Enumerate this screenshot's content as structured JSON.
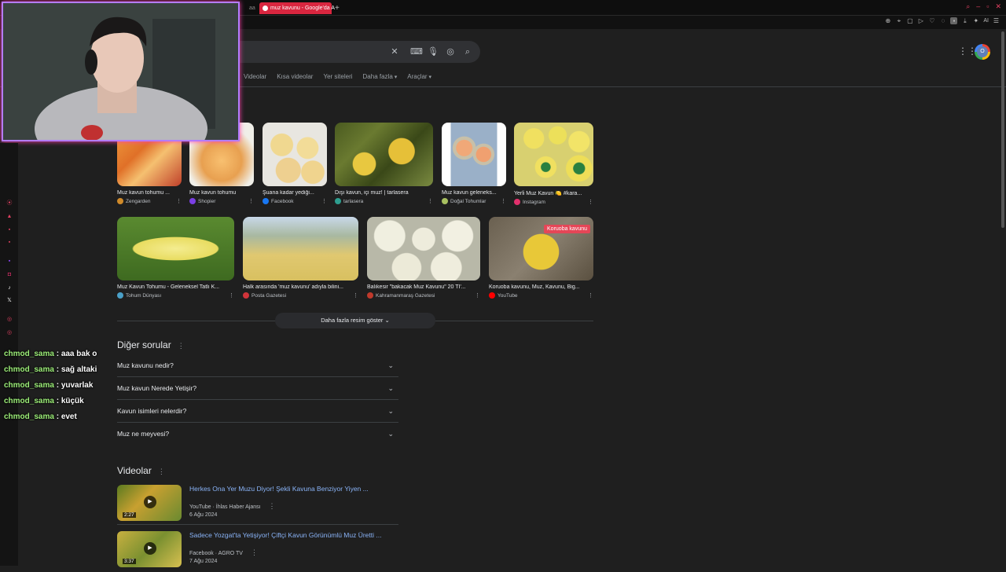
{
  "browser": {
    "inactive_tab": "aaining",
    "active_tab": "muz kavunu - Google'da A",
    "new_tab": "+",
    "ai_label": "AI"
  },
  "google": {
    "account_initial": "O",
    "nav": [
      "Videolar",
      "Kısa videolar",
      "Yer siteleri",
      "Daha fazla",
      "Araçlar"
    ]
  },
  "images": {
    "row1": [
      {
        "title": "Muz kavun tohumu ...",
        "source": "Zengarden",
        "src_color": "#d08a2a"
      },
      {
        "title": "Muz kavun tohumu",
        "source": "Shopier",
        "src_color": "#7b3fe4"
      },
      {
        "title": "Şuana kadar yediği...",
        "source": "Facebook",
        "src_color": "#1877f2"
      },
      {
        "title": "Dışı kavun, içi muz! | tarlasera",
        "source": "tarlasera",
        "src_color": "#2e9e8f"
      },
      {
        "title": "Muz kavun geleneks...",
        "source": "Doğal Tohumlar",
        "src_color": "#a8c060"
      },
      {
        "title": "Yerli Muz Kavun 🍋 #kara...",
        "source": "Instagram",
        "src_color": "#e1306c"
      }
    ],
    "row2": [
      {
        "title": "Muz Kavun Tohumu - Geleneksel Tatlı K...",
        "source": "Tohum Dünyası",
        "src_color": "#4aa0c8"
      },
      {
        "title": "Halk arasında 'muz kavunu' adıyla bilini...",
        "source": "Posta Gazetesi",
        "src_color": "#d0343a"
      },
      {
        "title": "Balıkesir \"bakacak Muz Kavunu\" 20 TI'...",
        "source": "Kahramanmaraş Gazetesi",
        "src_color": "#c0392b"
      },
      {
        "title": "Koruoba kavunu, Muz, Kavunu, Big...",
        "source": "YouTube",
        "src_color": "#ff0000",
        "badge": "Koruoba kavunu"
      }
    ],
    "show_more": "Daha fazla resim göster"
  },
  "paa": {
    "title": "Diğer sorular",
    "questions": [
      "Muz kavunu nedir?",
      "Muz kavun Nerede Yetişir?",
      "Kavun isimleri nelerdir?",
      "Muz ne meyvesi?"
    ]
  },
  "videos": {
    "title": "Videolar",
    "items": [
      {
        "title": "Herkes Ona Yer Muzu Diyor! Şekli Kavuna Benziyor Yiyen ...",
        "platform": "YouTube",
        "channel": "İhlas Haber Ajansı",
        "date": "6 Ağu 2024",
        "duration": "2:27"
      },
      {
        "title": "Sadece Yozgat'ta Yetişiyor! Çiftçi Kavun Görünümlü Muz Üretti ...",
        "platform": "Facebook",
        "channel": "AGRO TV",
        "date": "7 Ağu 2024",
        "duration": "3:37"
      }
    ]
  },
  "chat": [
    {
      "user": "chmod_sama",
      "msg": "aaa bak o"
    },
    {
      "user": "chmod_sama",
      "msg": "sağ altaki"
    },
    {
      "user": "chmod_sama",
      "msg": "yuvarlak"
    },
    {
      "user": "chmod_sama",
      "msg": "küçük"
    },
    {
      "user": "chmod_sama",
      "msg": "evet"
    }
  ]
}
